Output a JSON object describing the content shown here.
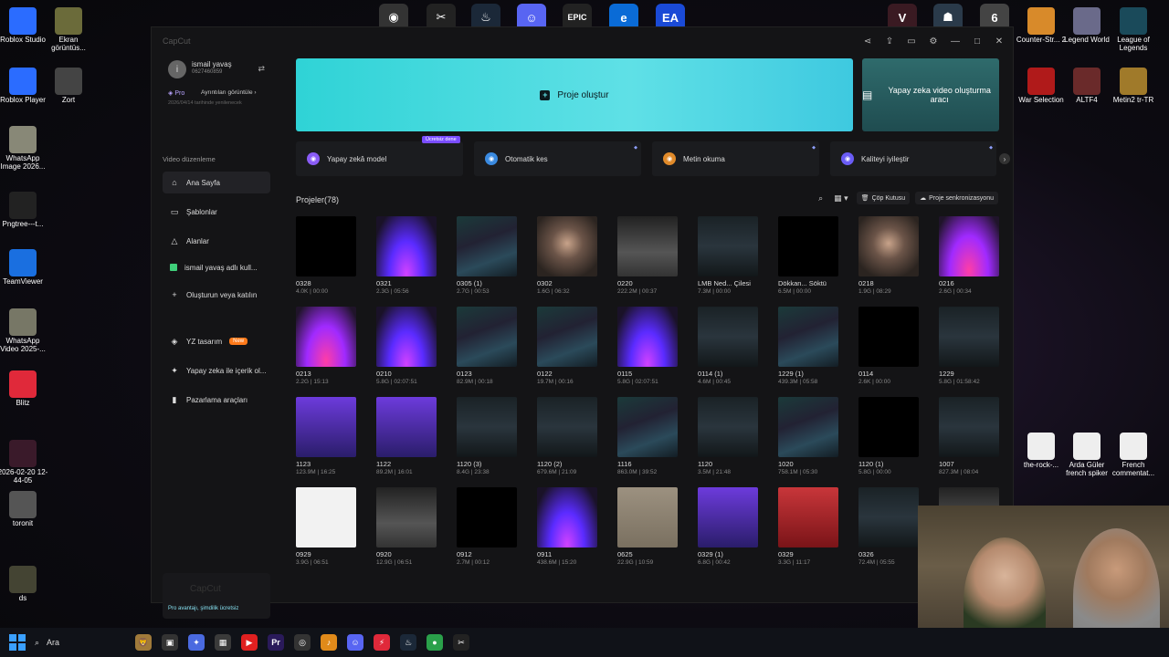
{
  "desktop": {
    "left_icons": [
      {
        "label": "Roblox Studio",
        "icon": "roblox-studio-icon",
        "color": "#2b6cff"
      },
      {
        "label": "Ekran görüntüs...",
        "icon": "screenshot-icon",
        "color": "#6b6b3a"
      },
      {
        "label": "Roblox Player",
        "icon": "roblox-player-icon",
        "color": "#2b6cff"
      },
      {
        "label": "Zort",
        "icon": "zort-icon",
        "color": "#444"
      },
      {
        "label": "WhatsApp Image 2026...",
        "icon": "image-file-icon",
        "color": "#887"
      },
      {
        "label": "Pngtree---t...",
        "icon": "image-file-icon",
        "color": "#222"
      },
      {
        "label": "TeamViewer",
        "icon": "teamviewer-icon",
        "color": "#1a6fe0"
      },
      {
        "label": "WhatsApp Video 2025-...",
        "icon": "video-file-icon",
        "color": "#776"
      },
      {
        "label": "Blitz",
        "icon": "blitz-icon",
        "color": "#e0293a"
      },
      {
        "label": "2026-02-20 12-44-05",
        "icon": "video-file-icon",
        "color": "#3a1a2a"
      },
      {
        "label": "toronit",
        "icon": "file-icon",
        "color": "#555"
      },
      {
        "label": "ds",
        "icon": "file-icon",
        "color": "#443"
      }
    ],
    "right_icons": [
      {
        "label": "Counter-Str... 2",
        "icon": "counter-strike-icon",
        "color": "#d88a2a"
      },
      {
        "label": "Legend World",
        "icon": "legend-world-icon",
        "color": "#6a6a8a"
      },
      {
        "label": "League of Legends",
        "icon": "league-of-legends-icon",
        "color": "#1a4a5a"
      },
      {
        "label": "War Selection",
        "icon": "war-selection-icon",
        "color": "#b01a1a"
      },
      {
        "label": "ALTF4",
        "icon": "altf4-icon",
        "color": "#6a2a2a"
      },
      {
        "label": "Metin2 tr-TR",
        "icon": "metin2-icon",
        "color": "#a07a2a"
      },
      {
        "label": "the-rock-...",
        "icon": "video-file-icon",
        "color": "#eee"
      },
      {
        "label": "Arda Güler french spiker",
        "icon": "video-file-icon",
        "color": "#eee"
      },
      {
        "label": "French commentat...",
        "icon": "video-file-icon",
        "color": "#eee"
      }
    ],
    "top_icons": [
      {
        "icon": "obs-icon",
        "label": "◉",
        "color": "#333"
      },
      {
        "icon": "capcut-icon",
        "label": "✂",
        "color": "#222"
      },
      {
        "icon": "steam-icon",
        "label": "♨",
        "color": "#1b2838"
      },
      {
        "icon": "discord-icon",
        "label": "☺",
        "color": "#5865f2"
      },
      {
        "icon": "epic-games-icon",
        "label": "EPIC",
        "color": "#222"
      },
      {
        "icon": "edge-icon",
        "label": "e",
        "color": "#0a6bd6"
      },
      {
        "icon": "ea-icon",
        "label": "EA",
        "color": "#1a4ad6"
      },
      {
        "icon": "valorant-icon",
        "label": "V",
        "color": "#3a1a22"
      },
      {
        "icon": "game-icon",
        "label": "☗",
        "color": "#2a3a4a"
      },
      {
        "icon": "game-icon",
        "label": "6",
        "color": "#444"
      }
    ]
  },
  "app": {
    "title": "CapCut",
    "user": {
      "name": "ismail yavaş",
      "id": "0627460859",
      "avatar_letter": "i"
    },
    "pro": {
      "label": "Pro",
      "detail": "Ayrıntıları görüntüle",
      "renew": "2026/04/14 tarihinde yenilenecek"
    },
    "section_label": "Video düzenleme",
    "nav": [
      {
        "label": "Ana Sayfa",
        "icon": "home-icon",
        "glyph": "⌂"
      },
      {
        "label": "Şablonlar",
        "icon": "template-icon",
        "glyph": "▭"
      },
      {
        "label": "Alanlar",
        "icon": "spaces-icon",
        "glyph": "△"
      },
      {
        "label": "ismail yavaş adlı kull...",
        "icon": "user-space-icon",
        "glyph": ""
      },
      {
        "label": "Oluşturun veya katılın",
        "icon": "plus-icon",
        "glyph": "+"
      },
      {
        "label": "YZ tasarım",
        "icon": "ai-design-icon",
        "glyph": "◈",
        "badge": "New"
      },
      {
        "label": "Yapay zeka ile içerik ol...",
        "icon": "ai-content-icon",
        "glyph": "✦"
      },
      {
        "label": "Pazarlama araçları",
        "icon": "marketing-icon",
        "glyph": "▮"
      }
    ],
    "promo": {
      "logo": "CapCut",
      "text": "Pro avantajı, şimdilik ücretsiz"
    },
    "create": {
      "label": "Proje oluştur"
    },
    "ai_video": {
      "label": "Yapay zeka video oluşturma aracı"
    },
    "tools": [
      {
        "label": "Yapay zekâ model",
        "icon": "ai-model-icon",
        "color": "#8a5cf6",
        "free": "Ücretsiz dene"
      },
      {
        "label": "Otomatik kes",
        "icon": "auto-cut-icon",
        "color": "#3a8ae0"
      },
      {
        "label": "Metin okuma",
        "icon": "text-to-speech-icon",
        "color": "#e08a2a"
      },
      {
        "label": "Kaliteyi iyileştir",
        "icon": "enhance-icon",
        "color": "#6a5cf6"
      }
    ],
    "projects_label": "Projeler(78)",
    "trash_label": "Çöp Kutusu",
    "sync_label": "Proje senkronizasyonu"
  },
  "projects": [
    {
      "name": "0328",
      "meta": "4.0K | 00:00",
      "style": "black"
    },
    {
      "name": "0321",
      "meta": "2.3G | 05:56",
      "style": "purple"
    },
    {
      "name": "0305 (1)",
      "meta": "2.7G | 00:53",
      "style": "game"
    },
    {
      "name": "0302",
      "meta": "1.6G | 06:32",
      "style": "face"
    },
    {
      "name": "0220",
      "meta": "222.2M | 00:37",
      "style": "grey"
    },
    {
      "name": "LMB Ned... Çilesi",
      "meta": "7.3M | 00:00",
      "style": "ui"
    },
    {
      "name": "Dökkan... Söktü",
      "meta": "6.5M | 00:00",
      "style": "black"
    },
    {
      "name": "0218",
      "meta": "1.9G | 08:29",
      "style": "face"
    },
    {
      "name": "0216",
      "meta": "2.6G | 00:34",
      "style": "pink"
    },
    {
      "name": "0213",
      "meta": "2.2G | 15:13",
      "style": "pink"
    },
    {
      "name": "0210",
      "meta": "5.8G | 02:07:51",
      "style": "purple"
    },
    {
      "name": "0123",
      "meta": "82.9M | 00:18",
      "style": "game"
    },
    {
      "name": "0122",
      "meta": "19.7M | 00:16",
      "style": "game"
    },
    {
      "name": "0115",
      "meta": "5.8G | 02:07:51",
      "style": "purple"
    },
    {
      "name": "0114 (1)",
      "meta": "4.6M | 00:45",
      "style": "ui"
    },
    {
      "name": "1229 (1)",
      "meta": "439.3M | 05:58",
      "style": "game"
    },
    {
      "name": "0114",
      "meta": "2.6K | 00:00",
      "style": "black"
    },
    {
      "name": "1229",
      "meta": "5.8G | 01:58:42",
      "style": "ui"
    },
    {
      "name": "1123",
      "meta": "123.9M | 16:25",
      "style": "violet"
    },
    {
      "name": "1122",
      "meta": "89.2M | 16:01",
      "style": "violet"
    },
    {
      "name": "1120 (3)",
      "meta": "8.4G | 23:38",
      "style": "ui"
    },
    {
      "name": "1120 (2)",
      "meta": "679.6M | 21:09",
      "style": "ui"
    },
    {
      "name": "1116",
      "meta": "863.0M | 39:52",
      "style": "game"
    },
    {
      "name": "1120",
      "meta": "3.5M | 21:48",
      "style": "ui"
    },
    {
      "name": "1020",
      "meta": "758.1M | 05:30",
      "style": "game"
    },
    {
      "name": "1120 (1)",
      "meta": "5.8G | 00:00",
      "style": "black"
    },
    {
      "name": "1007",
      "meta": "827.3M | 08:04",
      "style": "ui"
    },
    {
      "name": "0929",
      "meta": "3.9G | 06:51",
      "style": "white"
    },
    {
      "name": "0920",
      "meta": "12.9G | 06:51",
      "style": "grey"
    },
    {
      "name": "0912",
      "meta": "2.7M | 00:12",
      "style": "black"
    },
    {
      "name": "0911",
      "meta": "438.6M | 15:20",
      "style": "purple"
    },
    {
      "name": "0625",
      "meta": "22.9G | 10:59",
      "style": "room"
    },
    {
      "name": "0329 (1)",
      "meta": "6.8G | 00:42",
      "style": "violet"
    },
    {
      "name": "0329",
      "meta": "3.3G | 11:17",
      "style": "red"
    },
    {
      "name": "0326",
      "meta": "72.4M | 05:55",
      "style": "ui"
    },
    {
      "name": "",
      "meta": "",
      "style": "grey"
    }
  ],
  "taskbar": {
    "search_label": "Ara",
    "apps": [
      {
        "icon": "lion-wallpaper-icon",
        "label": "🦁",
        "color": "#a07a3a"
      },
      {
        "icon": "files-icon",
        "label": "▣",
        "color": "#333"
      },
      {
        "icon": "copilot-icon",
        "label": "✦",
        "color": "#4a6ae0"
      },
      {
        "icon": "store-icon",
        "label": "▦",
        "color": "#3a3a3a"
      },
      {
        "icon": "youtube-icon",
        "label": "▶",
        "color": "#e02020"
      },
      {
        "icon": "premiere-icon",
        "label": "Pr",
        "color": "#2a1a5a"
      },
      {
        "icon": "vpn-icon",
        "label": "◎",
        "color": "#333"
      },
      {
        "icon": "fl-studio-icon",
        "label": "♪",
        "color": "#e08a1a"
      },
      {
        "icon": "discord-icon",
        "label": "☺",
        "color": "#5865f2"
      },
      {
        "icon": "blitz-icon",
        "label": "⚡",
        "color": "#e0293a"
      },
      {
        "icon": "steam-icon",
        "label": "♨",
        "color": "#1b2838"
      },
      {
        "icon": "chrome-icon",
        "label": "●",
        "color": "#2aa04a"
      },
      {
        "icon": "capcut-icon",
        "label": "✂",
        "color": "#222"
      }
    ]
  }
}
